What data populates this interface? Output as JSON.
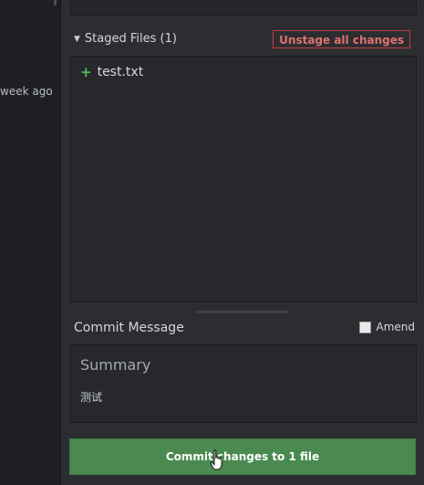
{
  "history": {
    "time_text": "week ago"
  },
  "staged": {
    "header": "Staged Files (1)",
    "unstage_label": "Unstage all changes",
    "files": [
      {
        "status": "+",
        "name": "test.txt"
      }
    ]
  },
  "commit": {
    "label": "Commit Message",
    "amend_label": "Amend",
    "summary_placeholder": "Summary",
    "description": "测试",
    "button_label": "Commit changes to 1 file"
  },
  "colors": {
    "accent_green": "#4a8a50",
    "danger": "#c43e3e",
    "added": "#5cb85c"
  },
  "icons": [
    "caret-down-icon",
    "plus-icon",
    "hand-cursor-icon"
  ]
}
